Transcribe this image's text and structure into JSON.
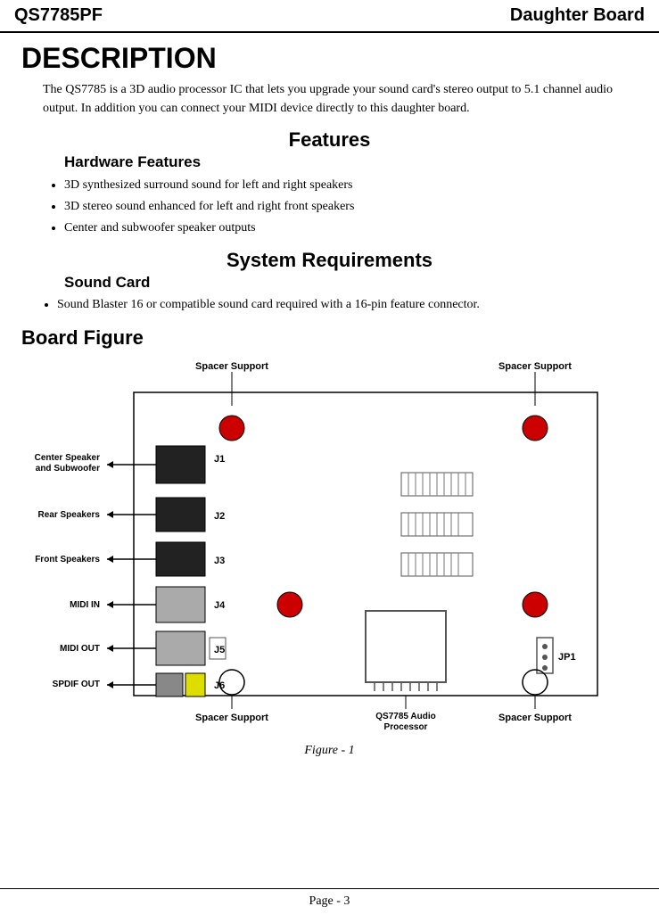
{
  "header": {
    "left": "QS7785PF",
    "right": "Daughter Board"
  },
  "description": {
    "title": "DESCRIPTION",
    "text": "The QS7785 is a 3D audio processor IC that lets you upgrade your sound card's stereo output to 5.1 channel audio output. In addition you can connect your MIDI device directly to this daughter board."
  },
  "features": {
    "title": "Features",
    "hardware_title": "Hardware Features",
    "bullets": [
      "3D synthesized surround sound for left and right speakers",
      "3D stereo sound enhanced for left and right front speakers",
      "Center and subwoofer speaker outputs"
    ]
  },
  "system_requirements": {
    "title": "System Requirements",
    "sound_card_title": "Sound Card",
    "bullets": [
      "Sound Blaster 16 or compatible sound card required with a 16-pin feature connector."
    ]
  },
  "board_figure": {
    "title": "Board Figure",
    "labels": {
      "spacer_top_left": "Spacer Support",
      "spacer_top_right": "Spacer Support",
      "spacer_bottom_left": "Spacer Support",
      "spacer_bottom_right": "Spacer Support",
      "qs7785": "QS7785 Audio\nProcessor",
      "center_speaker": "Center Speaker\nand Subwoofer",
      "rear_speakers": "Rear Speakers",
      "front_speakers": "Front Speakers",
      "midi_in": "MIDI IN",
      "midi_out": "MIDI OUT",
      "spdif_out": "SPDIF OUT",
      "j1": "J1",
      "j2": "J2",
      "j3": "J3",
      "j4": "J4",
      "j5": "J5",
      "j6": "J6",
      "jp1": "JP1"
    },
    "caption": "Figure - 1"
  },
  "footer": {
    "text": "Page - 3"
  }
}
